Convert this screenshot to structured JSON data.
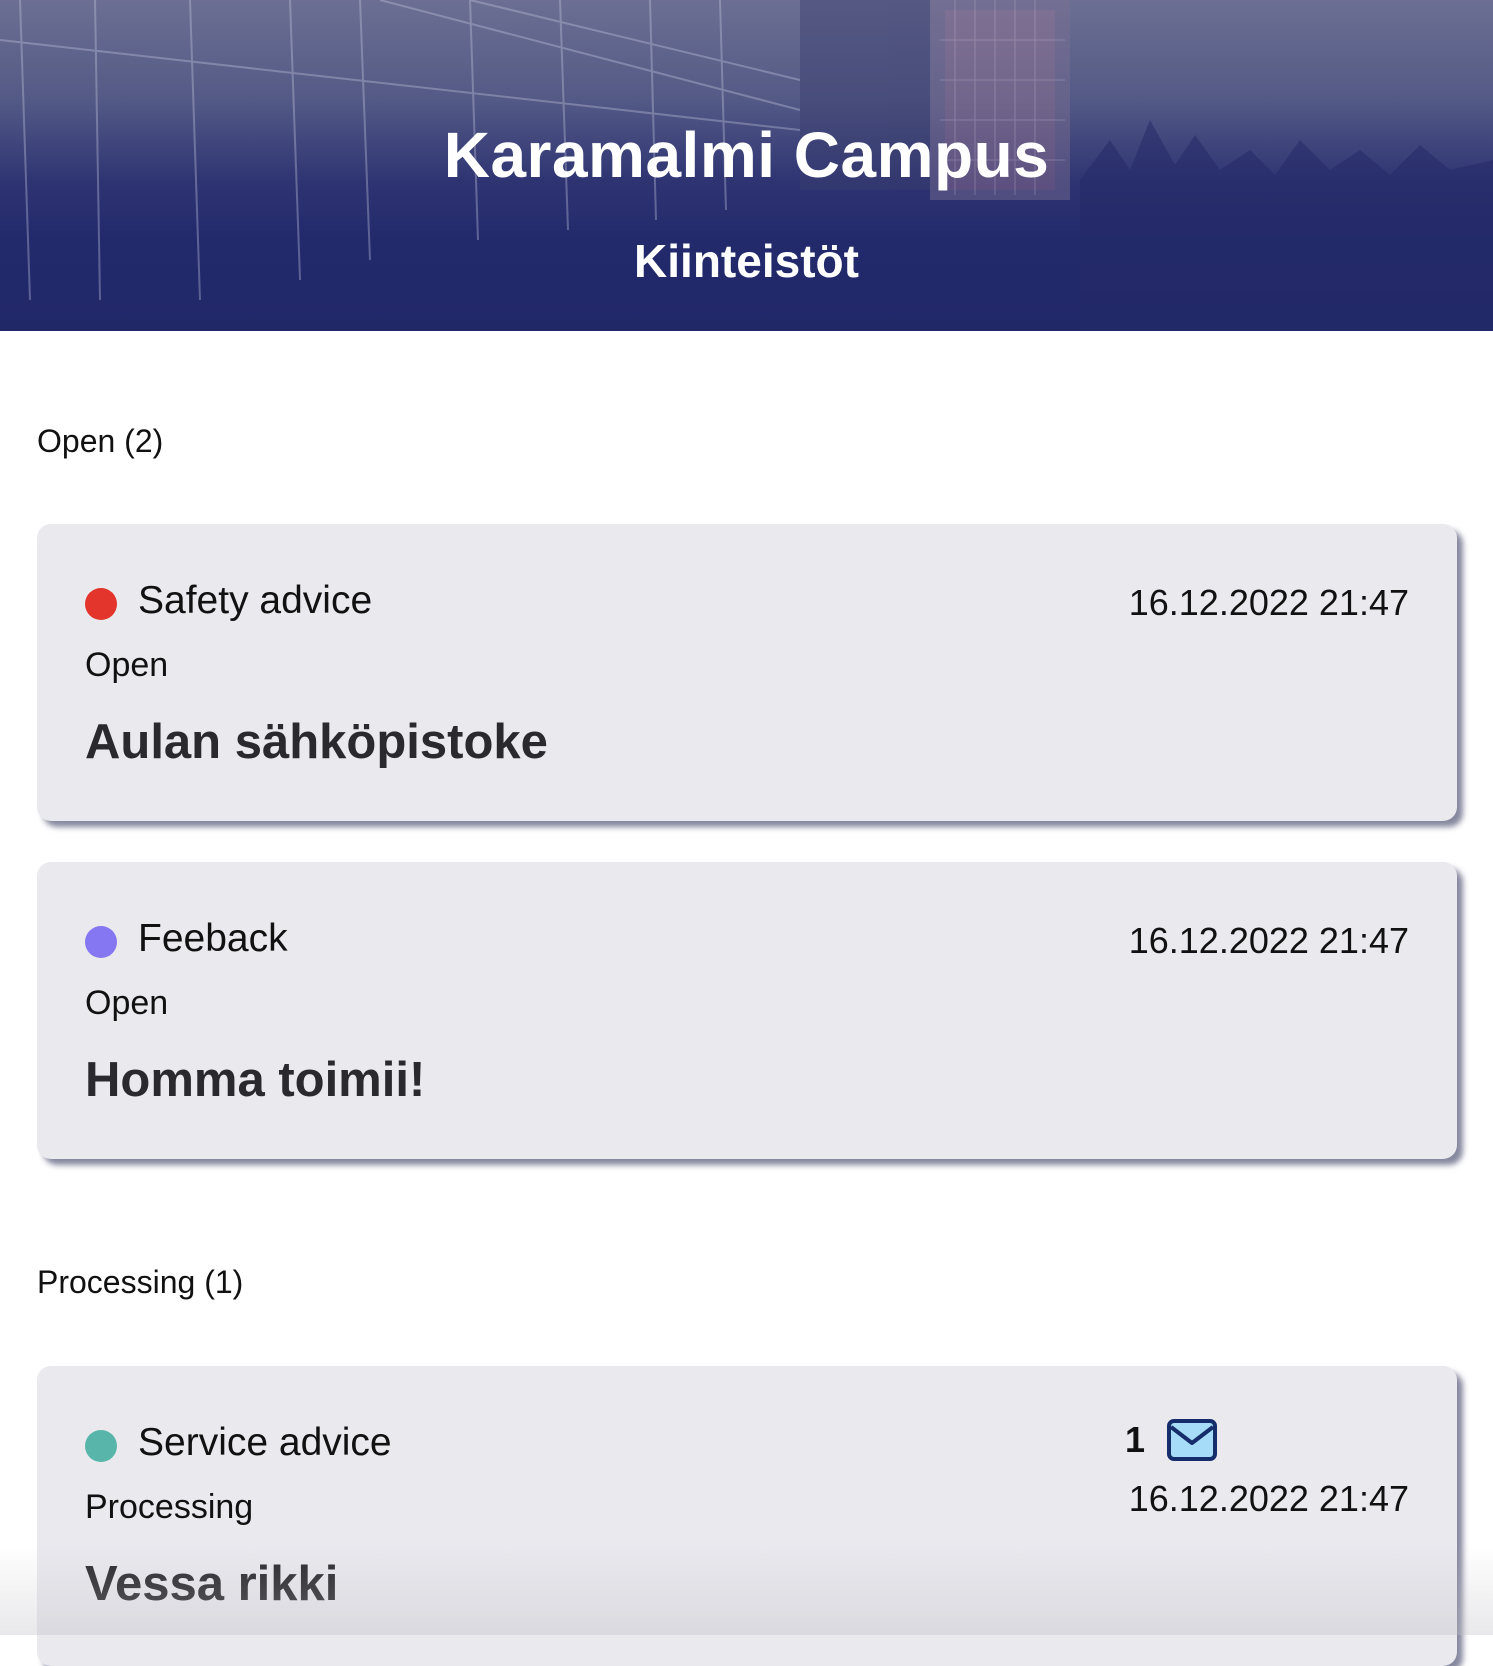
{
  "header": {
    "title": "Karamalmi Campus",
    "subtitle": "Kiinteistöt"
  },
  "sections": [
    {
      "heading": "Open (2)",
      "cards": [
        {
          "category": "Safety advice",
          "category_color": "#e3352b",
          "status": "Open",
          "title": "Aulan sähköpistoke",
          "datetime": "16.12.2022 21:47"
        },
        {
          "category": "Feeback",
          "category_color": "#8577f2",
          "status": "Open",
          "title": "Homma toimii!",
          "datetime": "16.12.2022 21:47"
        }
      ]
    },
    {
      "heading": "Processing (1)",
      "cards": [
        {
          "category": "Service advice",
          "category_color": "#58b5a9",
          "status": "Processing",
          "title": "Vessa rikki",
          "datetime": "16.12.2022 21:47",
          "message_count": "1",
          "message_icon": "envelope-icon"
        }
      ]
    }
  ],
  "colors": {
    "header_navy": "#212868",
    "card_background": "#e9e9ee",
    "mail_icon_fill": "#a6dcf7",
    "mail_icon_stroke": "#152d6a"
  }
}
